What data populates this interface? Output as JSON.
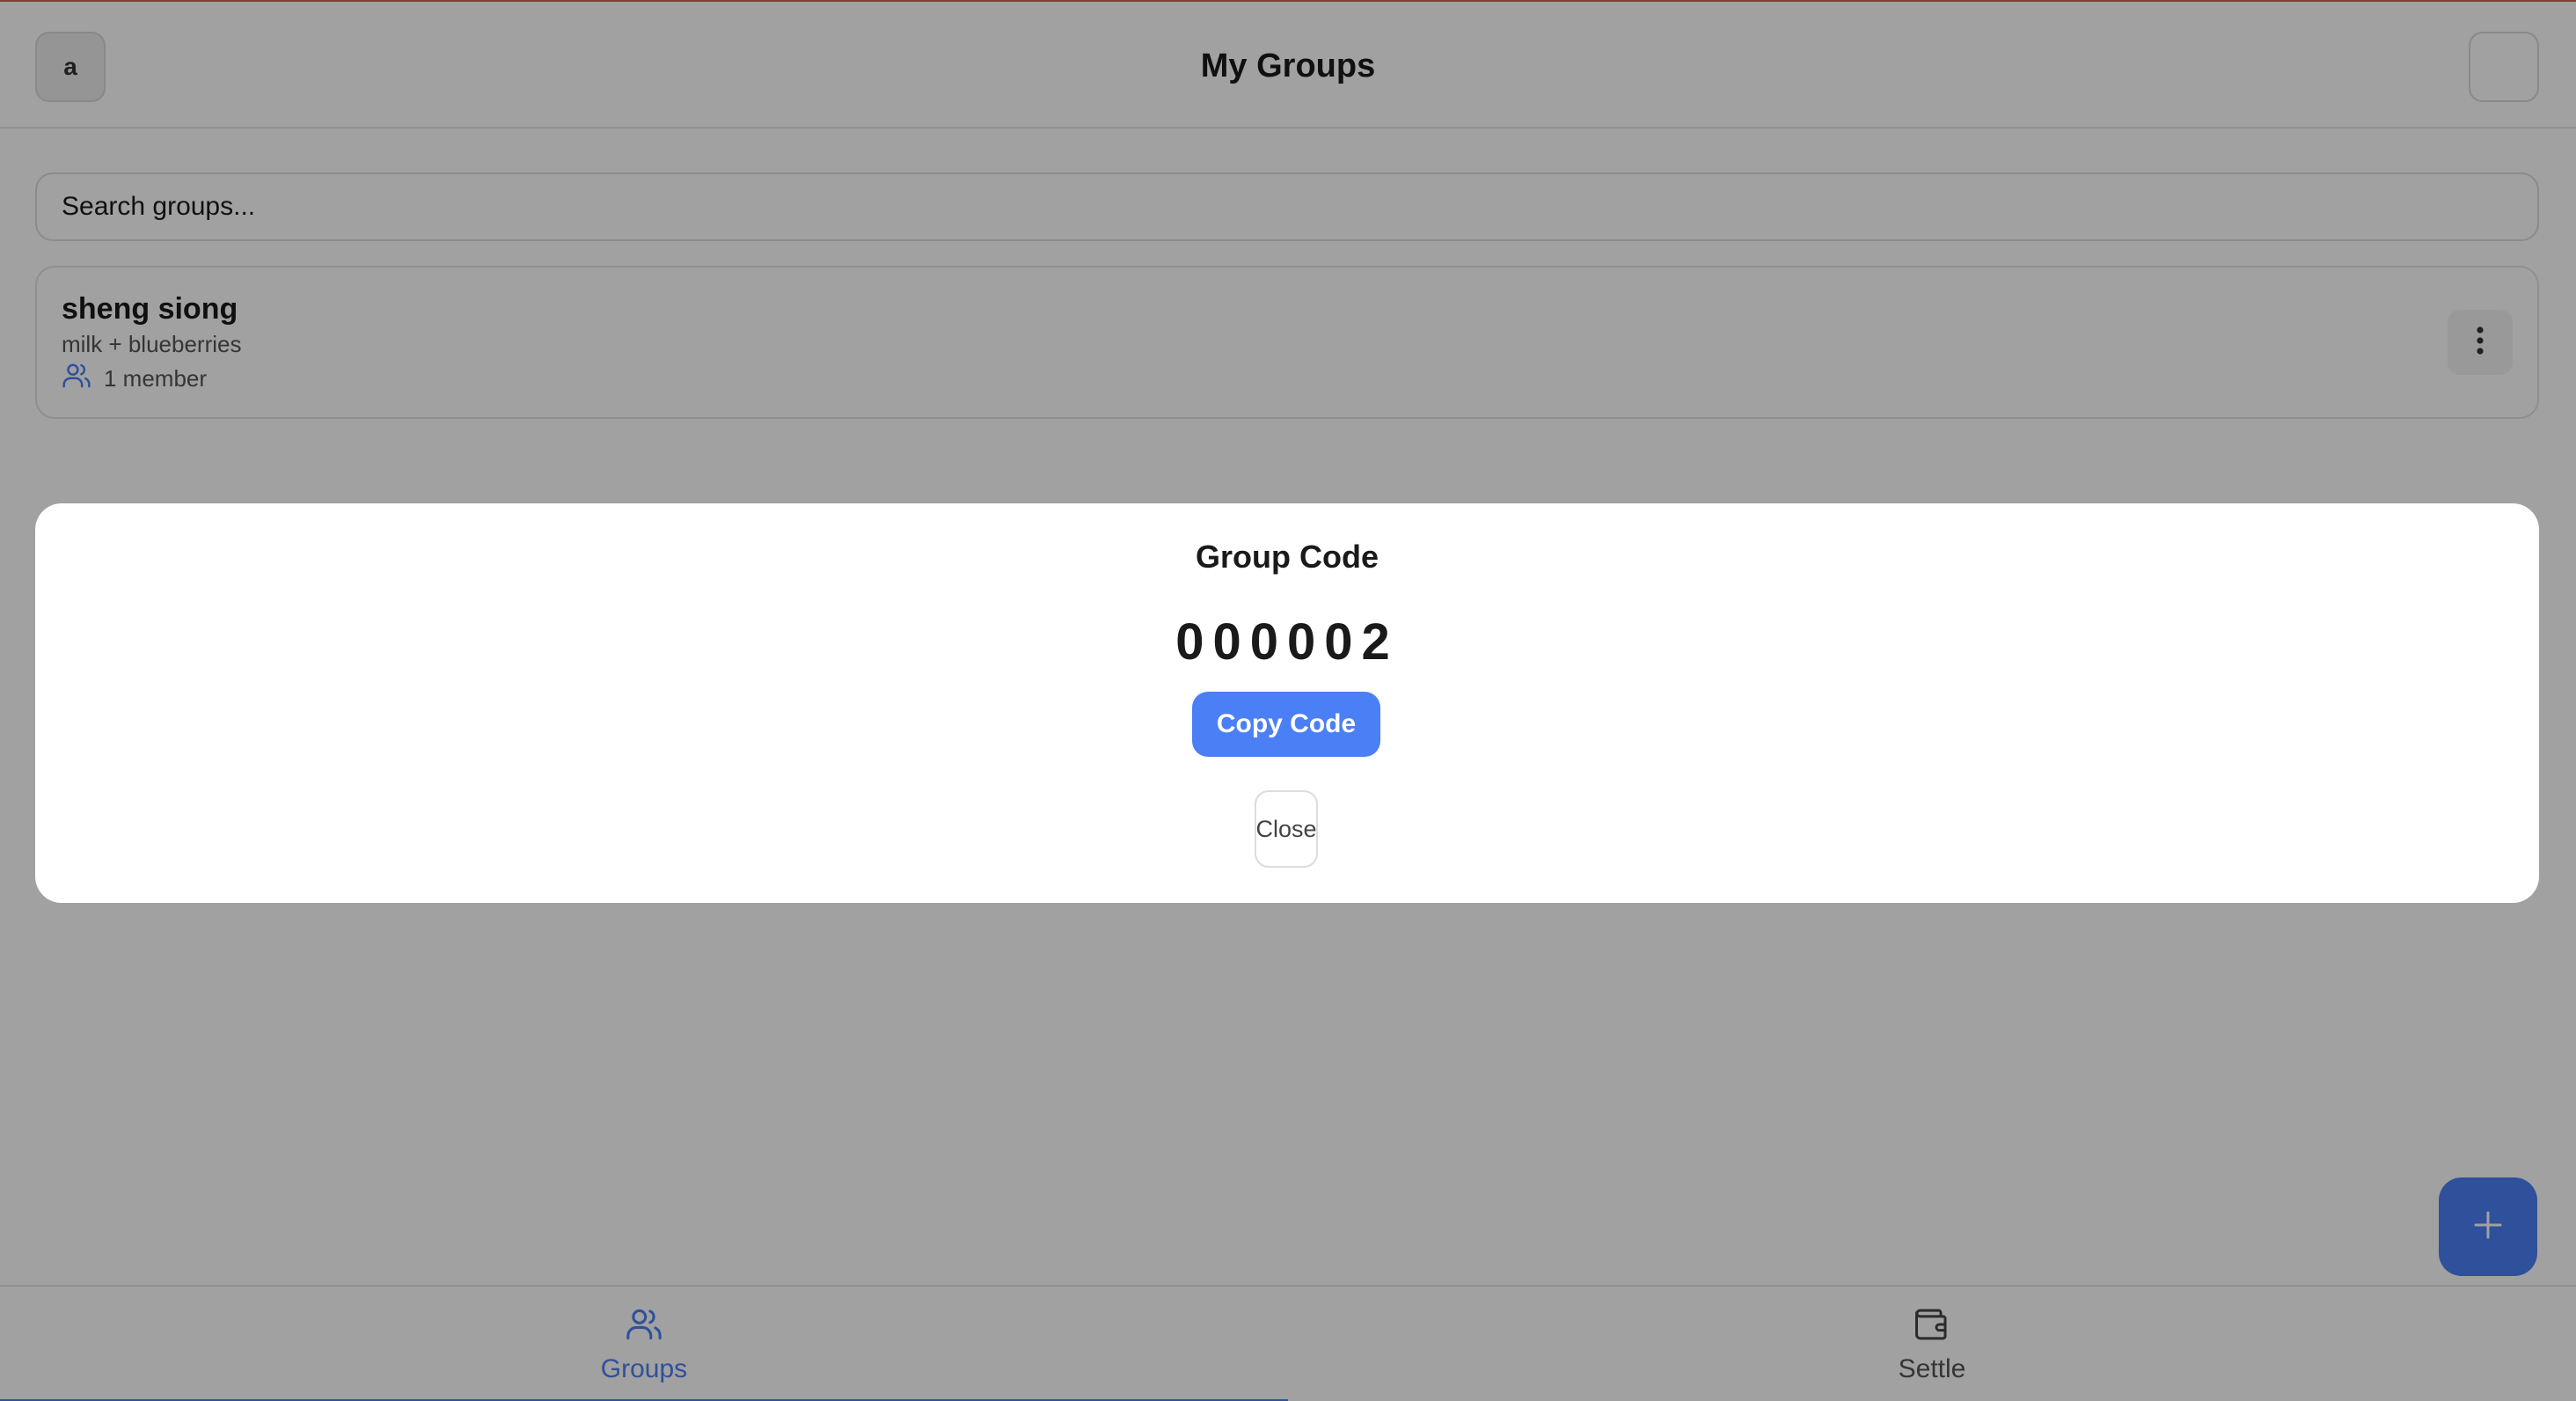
{
  "header": {
    "avatar_initial": "a",
    "title": "My Groups"
  },
  "search": {
    "placeholder": "Search groups..."
  },
  "groups": [
    {
      "name": "sheng siong",
      "description": "milk + blueberries",
      "members": "1 member"
    }
  ],
  "modal": {
    "title": "Group Code",
    "code": "000002",
    "copy_label": "Copy Code",
    "close_label": "Close"
  },
  "bottom_nav": {
    "items": [
      {
        "label": "Groups",
        "icon": "users-icon",
        "active": true
      },
      {
        "label": "Settle",
        "icon": "wallet-icon",
        "active": false
      }
    ]
  },
  "colors": {
    "accent": "#4b7ff5",
    "overlay": "rgba(0,0,0,0.37)"
  }
}
